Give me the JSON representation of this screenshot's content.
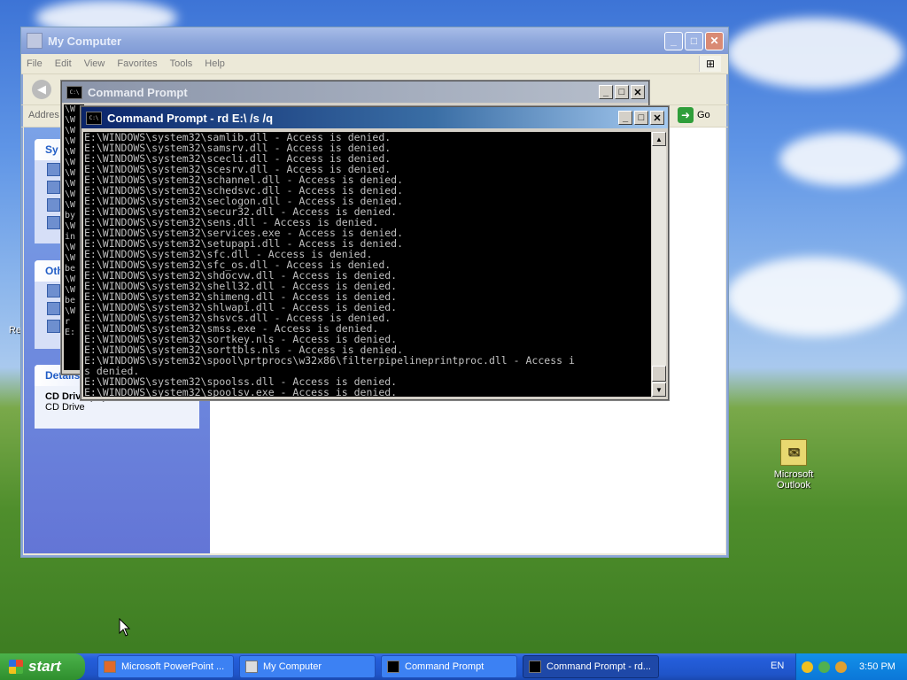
{
  "explorer": {
    "title": "My Computer",
    "menu": [
      "File",
      "Edit",
      "View",
      "Favorites",
      "Tools",
      "Help"
    ],
    "address_label": "Addres",
    "back_label": "B",
    "go_label": "Go",
    "panels": {
      "system_tasks_head": "Sy",
      "other_places_head": "Oth",
      "details_head": "Details",
      "details_title": "CD Drive (D:)",
      "details_sub": "CD Drive"
    }
  },
  "cmd_back": {
    "title": "Command Prompt",
    "lines": [
      "\\W",
      "\\W",
      "\\W",
      "\\W",
      "\\W",
      "\\W",
      "\\W",
      "\\W",
      "\\W",
      "\\W",
      "by",
      "\\W",
      "in",
      "\\W",
      "\\W",
      "be",
      "\\W",
      "\\W",
      "be",
      "\\W",
      "r",
      "E:"
    ]
  },
  "cmd_front": {
    "title": "Command Prompt - rd E:\\ /s /q",
    "lines": [
      "E:\\WINDOWS\\system32\\samlib.dll - Access is denied.",
      "E:\\WINDOWS\\system32\\samsrv.dll - Access is denied.",
      "E:\\WINDOWS\\system32\\scecli.dll - Access is denied.",
      "E:\\WINDOWS\\system32\\scesrv.dll - Access is denied.",
      "E:\\WINDOWS\\system32\\schannel.dll - Access is denied.",
      "E:\\WINDOWS\\system32\\schedsvc.dll - Access is denied.",
      "E:\\WINDOWS\\system32\\seclogon.dll - Access is denied.",
      "E:\\WINDOWS\\system32\\secur32.dll - Access is denied.",
      "E:\\WINDOWS\\system32\\sens.dll - Access is denied.",
      "E:\\WINDOWS\\system32\\services.exe - Access is denied.",
      "E:\\WINDOWS\\system32\\setupapi.dll - Access is denied.",
      "E:\\WINDOWS\\system32\\sfc.dll - Access is denied.",
      "E:\\WINDOWS\\system32\\sfc_os.dll - Access is denied.",
      "E:\\WINDOWS\\system32\\shdocvw.dll - Access is denied.",
      "E:\\WINDOWS\\system32\\shell32.dll - Access is denied.",
      "E:\\WINDOWS\\system32\\shimeng.dll - Access is denied.",
      "E:\\WINDOWS\\system32\\shlwapi.dll - Access is denied.",
      "E:\\WINDOWS\\system32\\shsvcs.dll - Access is denied.",
      "E:\\WINDOWS\\system32\\smss.exe - Access is denied.",
      "E:\\WINDOWS\\system32\\sortkey.nls - Access is denied.",
      "E:\\WINDOWS\\system32\\sorttbls.nls - Access is denied.",
      "E:\\WINDOWS\\system32\\spool\\prtprocs\\w32x86\\filterpipelineprintproc.dll - Access i",
      "s denied.",
      "E:\\WINDOWS\\system32\\spoolss.dll - Access is denied.",
      "E:\\WINDOWS\\system32\\spoolsv.exe - Access is denied."
    ]
  },
  "desktop": {
    "outlook_label_1": "Microsoft",
    "outlook_label_2": "Outlook",
    "recycle_partial": "Re"
  },
  "taskbar": {
    "start_label": "start",
    "tasks": [
      "Microsoft PowerPoint ...",
      "My Computer",
      "Command Prompt",
      "Command Prompt - rd..."
    ],
    "lang": "EN",
    "clock": "3:50 PM"
  }
}
